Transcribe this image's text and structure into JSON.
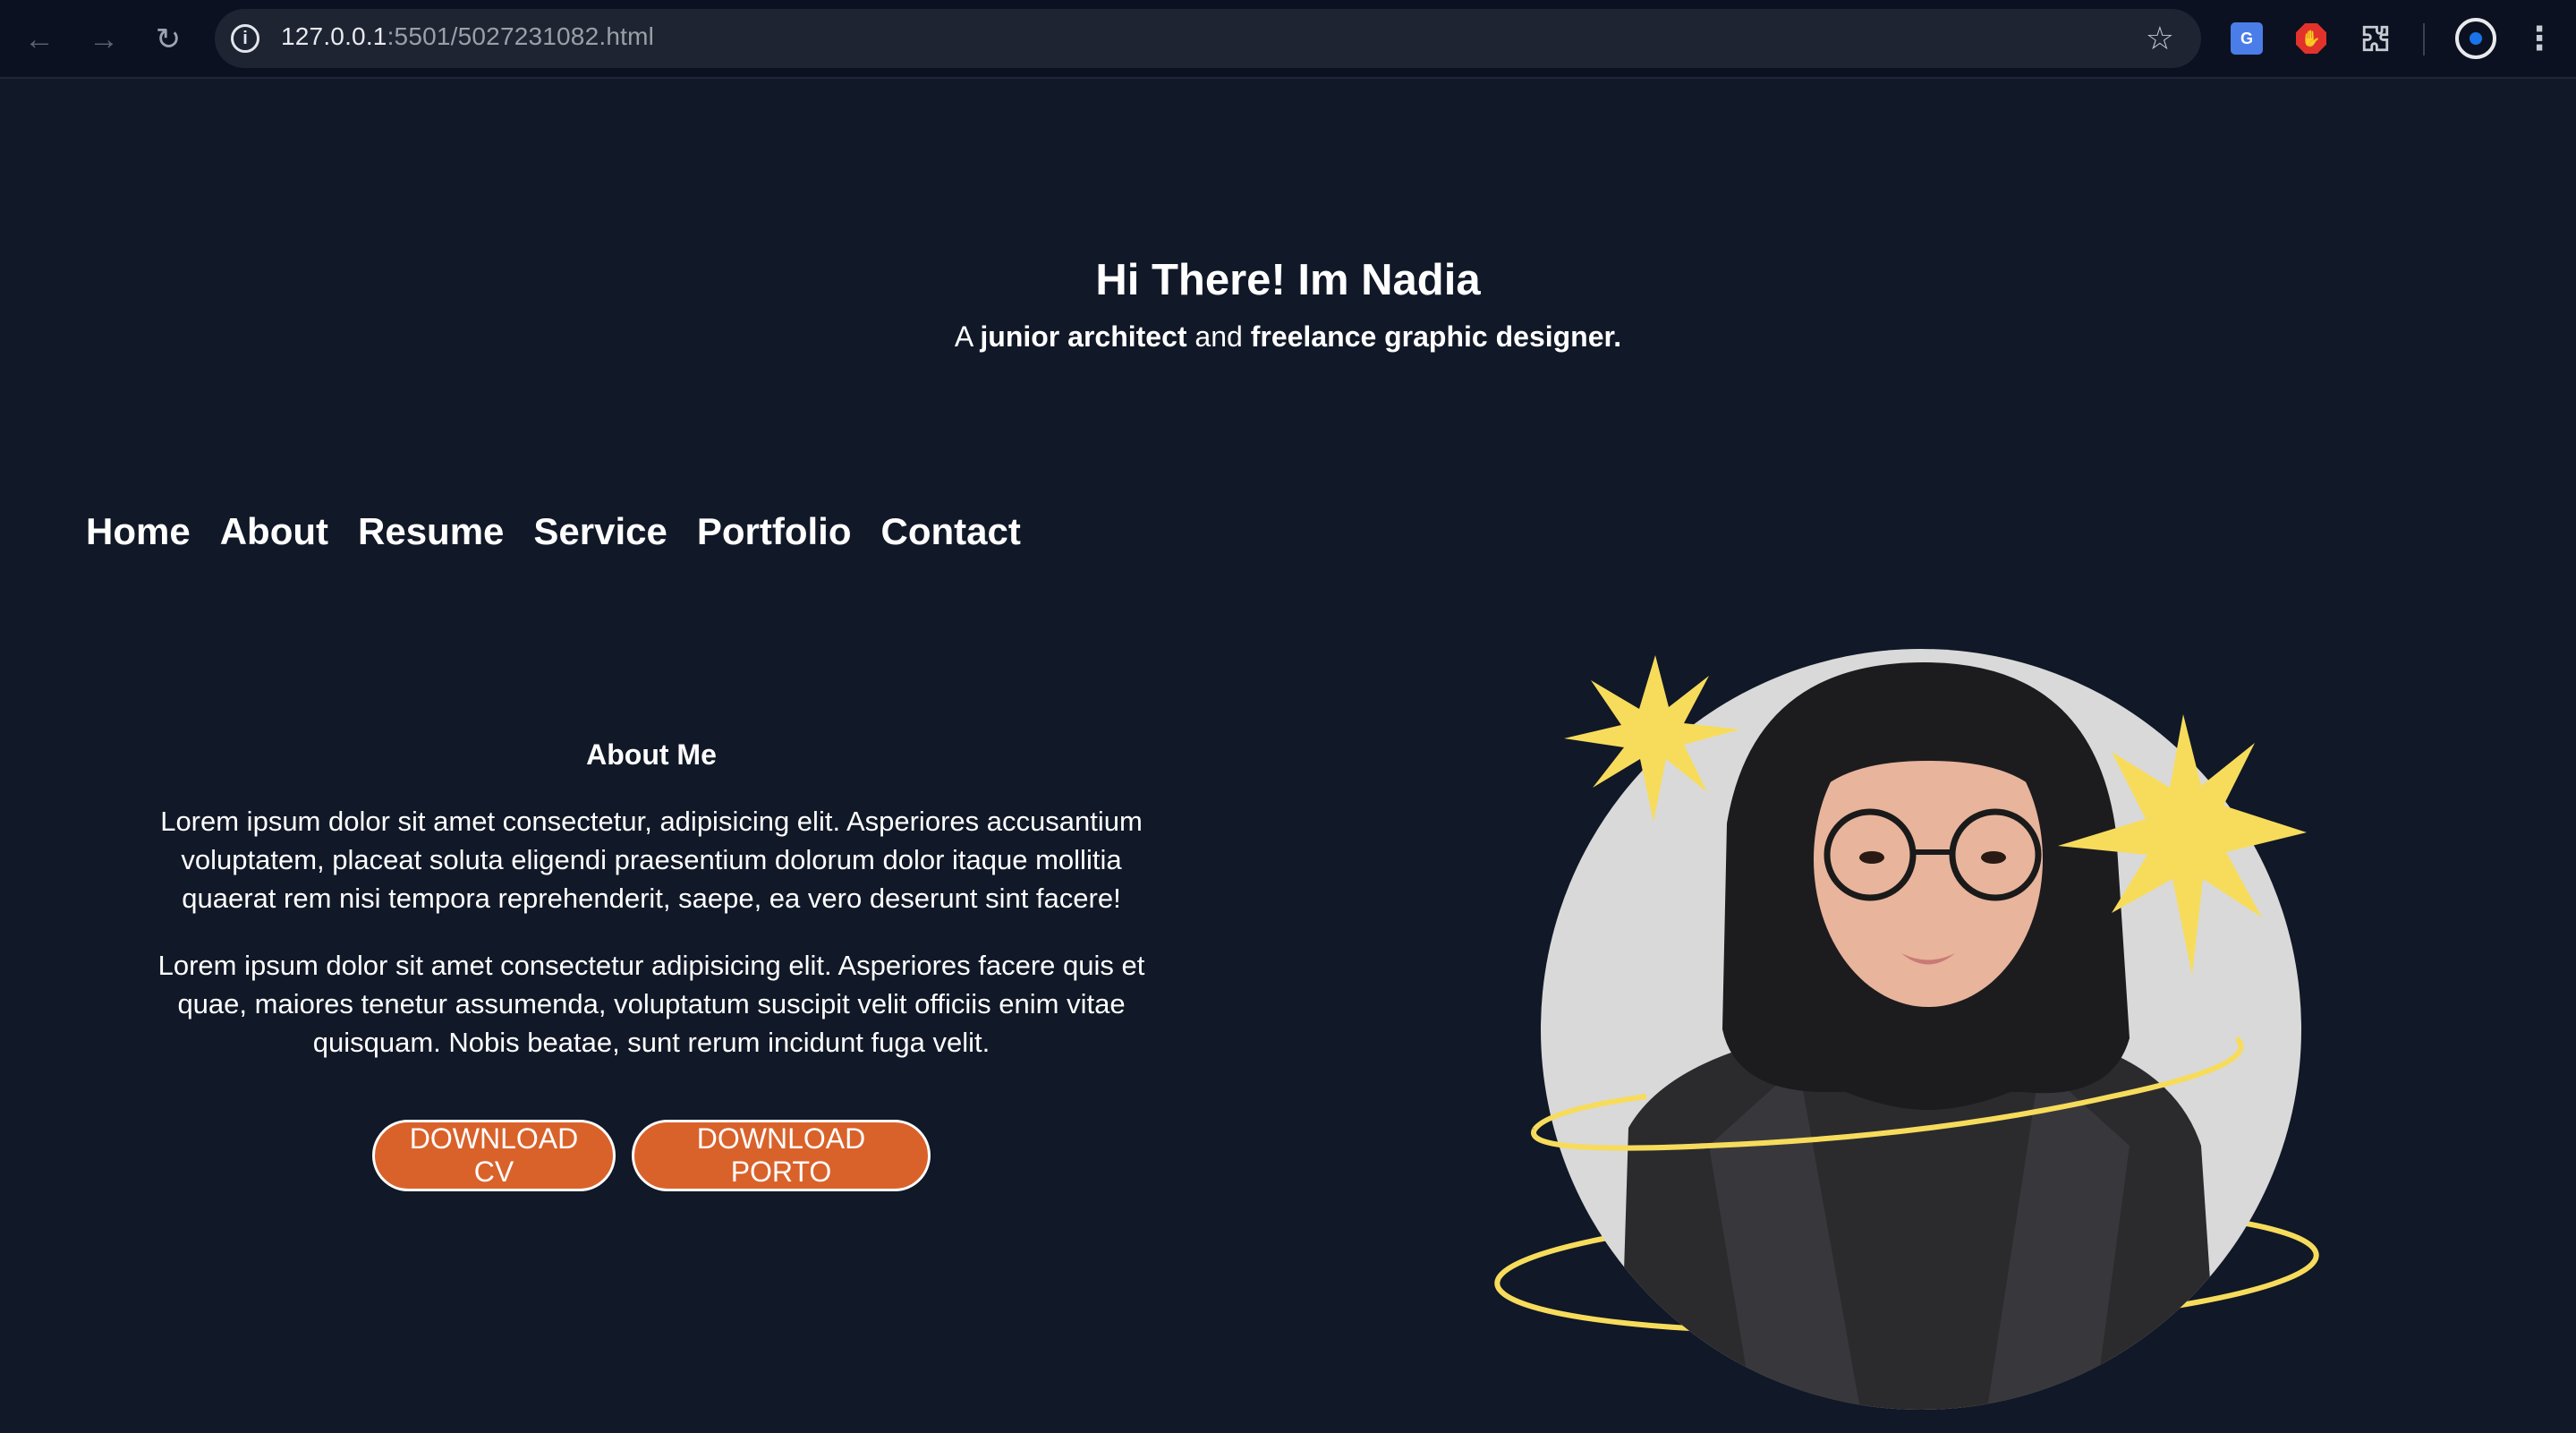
{
  "browser": {
    "url_host": "127.0.0.1",
    "url_path": ":5501/5027231082.html",
    "info_icon": "info-icon",
    "translate_label": "G"
  },
  "hero": {
    "title": "Hi There! Im Nadia",
    "sub_prefix": "A ",
    "sub_role1": "junior architect",
    "sub_middle": " and ",
    "sub_role2": "freelance graphic designer."
  },
  "nav": {
    "items": [
      {
        "label": "Home"
      },
      {
        "label": "About"
      },
      {
        "label": "Resume"
      },
      {
        "label": "Service"
      },
      {
        "label": "Portfolio"
      },
      {
        "label": "Contact"
      }
    ]
  },
  "about": {
    "heading": "About Me",
    "paragraph1": "Lorem ipsum dolor sit amet consectetur, adipisicing elit. Asperiores accusantium voluptatem, placeat soluta eligendi praesentium dolorum dolor itaque mollitia quaerat rem nisi tempora reprehenderit, saepe, ea vero deserunt sint facere!",
    "paragraph2": "Lorem ipsum dolor sit amet consectetur adipisicing elit. Asperiores facere quis et quae, maiores tenetur assumenda, voluptatum suscipit velit officiis enim vitae quisquam. Nobis beatae, sunt rerum incidunt fuga velit."
  },
  "buttons": {
    "cv_label": "DOWNLOAD CV",
    "porto_label": "DOWNLOAD PORTO"
  },
  "colors": {
    "background": "#111827",
    "button": "#d9622b",
    "accent_yellow": "#f7dc5c",
    "circle_bg": "#d9d9d9"
  }
}
